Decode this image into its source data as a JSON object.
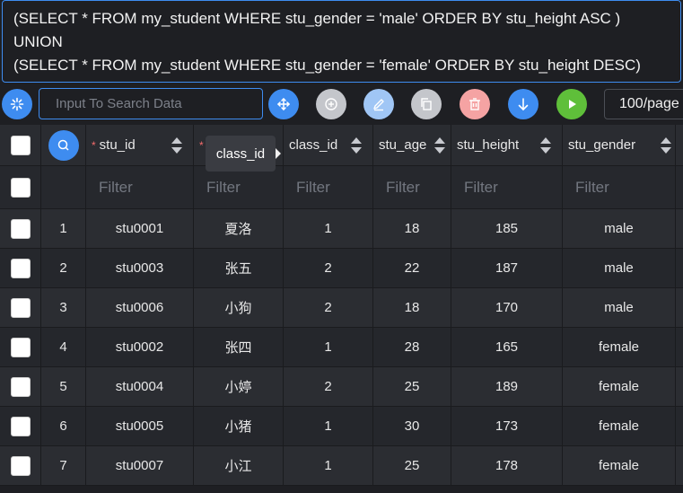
{
  "sql": {
    "lines": [
      "(SELECT * FROM my_student WHERE stu_gender = 'male' ORDER BY stu_height ASC )",
      "UNION",
      "(SELECT * FROM my_student WHERE stu_gender = 'female' ORDER BY stu_height DESC)"
    ]
  },
  "toolbar": {
    "search_placeholder": "Input To Search Data",
    "page_size": "100/page",
    "colors": {
      "refresh": "#3e8cf0",
      "move": "#3e8cf0",
      "add": "#c4c6cb",
      "edit": "#a0c6f5",
      "copy": "#c4c6cb",
      "delete": "#f5a3a3",
      "download": "#3e8cf0",
      "run": "#5fbf3a"
    }
  },
  "table": {
    "columns": [
      {
        "label": "stu_id",
        "required": true
      },
      {
        "label": "",
        "required": true
      },
      {
        "label": "class_id",
        "required": false
      },
      {
        "label": "stu_age",
        "required": false
      },
      {
        "label": "stu_height",
        "required": false
      },
      {
        "label": "stu_gender",
        "required": false
      }
    ],
    "filter_placeholder": "Filter",
    "rows": [
      {
        "n": "1",
        "stu_id": "stu0001",
        "name": "夏洛",
        "class_id": "1",
        "stu_age": "18",
        "stu_height": "185",
        "stu_gender": "male"
      },
      {
        "n": "2",
        "stu_id": "stu0003",
        "name": "张五",
        "class_id": "2",
        "stu_age": "22",
        "stu_height": "187",
        "stu_gender": "male"
      },
      {
        "n": "3",
        "stu_id": "stu0006",
        "name": "小狗",
        "class_id": "2",
        "stu_age": "18",
        "stu_height": "170",
        "stu_gender": "male"
      },
      {
        "n": "4",
        "stu_id": "stu0002",
        "name": "张四",
        "class_id": "1",
        "stu_age": "28",
        "stu_height": "165",
        "stu_gender": "female"
      },
      {
        "n": "5",
        "stu_id": "stu0004",
        "name": "小婷",
        "class_id": "2",
        "stu_age": "25",
        "stu_height": "189",
        "stu_gender": "female"
      },
      {
        "n": "6",
        "stu_id": "stu0005",
        "name": "小猪",
        "class_id": "1",
        "stu_age": "30",
        "stu_height": "173",
        "stu_gender": "female"
      },
      {
        "n": "7",
        "stu_id": "stu0007",
        "name": "小江",
        "class_id": "1",
        "stu_age": "25",
        "stu_height": "178",
        "stu_gender": "female"
      }
    ]
  },
  "tooltip": {
    "text": "class_id"
  }
}
